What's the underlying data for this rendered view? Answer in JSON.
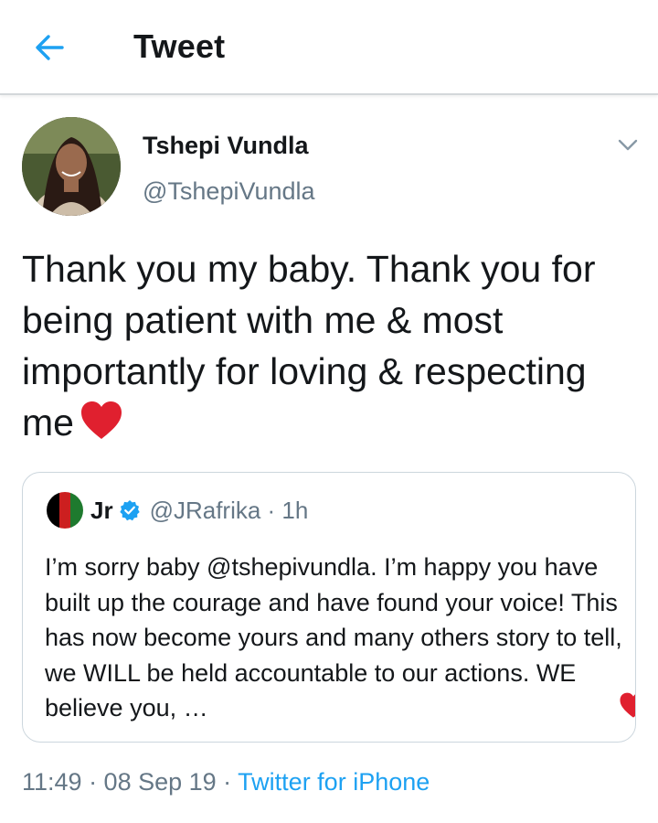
{
  "header": {
    "title": "Tweet"
  },
  "author": {
    "name": "Tshepi Vundla",
    "handle": "@TshepiVundla"
  },
  "tweet": {
    "text": "Thank you my baby. Thank you for being patient with me & most importantly for loving & respecting me"
  },
  "quoted": {
    "name": "Jr",
    "handle": "@JRafrika · 1h",
    "text": "I’m sorry baby @tshepivundla. I’m happy you have built up the courage and have found your voice! This has now become yours and many others story to tell, we WILL be held accountable to our actions. WE believe you, …"
  },
  "meta": {
    "time": "11:49 · 08 Sep 19 · ",
    "source": "Twitter for iPhone"
  },
  "icons": {
    "back": "arrow-left-icon",
    "more": "chevron-down-icon",
    "heart": "red-heart-icon",
    "verified": "verified-badge-icon"
  },
  "colors": {
    "accent": "#1da1f2",
    "secondary_text": "#657786",
    "heart": "#e0202f"
  }
}
